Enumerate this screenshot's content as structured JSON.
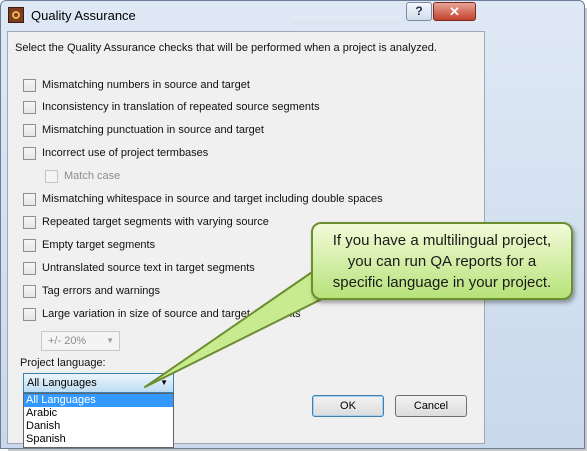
{
  "window": {
    "title": "Quality Assurance"
  },
  "intro": "Select the Quality Assurance checks that will be performed when a project is analyzed.",
  "checks": [
    {
      "label": "Mismatching numbers in source and target",
      "checked": false
    },
    {
      "label": "Inconsistency in translation of repeated source segments",
      "checked": false
    },
    {
      "label": "Mismatching punctuation in source and target",
      "checked": false
    },
    {
      "label": "Incorrect use of project termbases",
      "checked": false
    },
    {
      "label": "Match case",
      "checked": false,
      "disabled": true
    },
    {
      "label": "Mismatching whitespace in source and target including double spaces",
      "checked": false
    },
    {
      "label": "Repeated target segments with varying source",
      "checked": false
    },
    {
      "label": "Empty target segments",
      "checked": false
    },
    {
      "label": "Untranslated source text in target segments",
      "checked": false
    },
    {
      "label": "Tag errors and warnings",
      "checked": false
    },
    {
      "label": "Large variation in size of source and target segments",
      "checked": false
    }
  ],
  "tolerance": {
    "value": "+/- 20%"
  },
  "language": {
    "label": "Project language:",
    "selected": "All Languages",
    "options": [
      "All Languages",
      "Arabic",
      "Danish",
      "Spanish"
    ]
  },
  "buttons": {
    "ok": "OK",
    "cancel": "Cancel"
  },
  "callout": {
    "lines": [
      "If you have a multilingual project,",
      "you can run QA reports for a",
      "specific language in your project."
    ]
  }
}
